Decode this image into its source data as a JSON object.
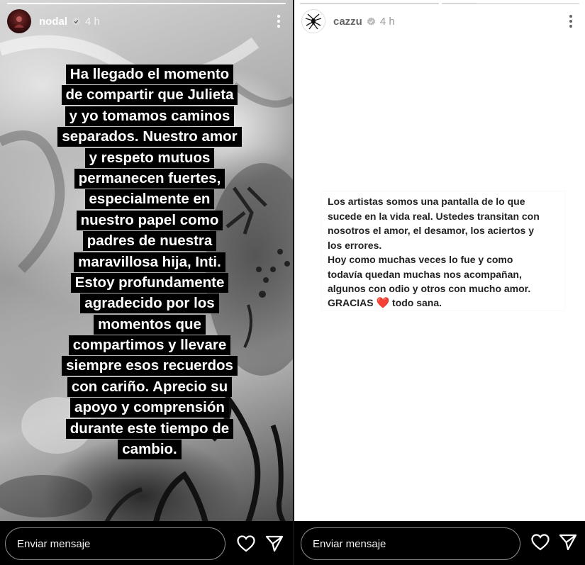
{
  "left_story": {
    "username": "nodal",
    "time": "4 h",
    "progress_fill": 1.0,
    "text_lines": [
      "Ha llegado el momento",
      "de compartir que Julieta",
      "y yo tomamos caminos",
      "separados. Nuestro amor",
      "y respeto mutuos",
      "permanecen fuertes,",
      "especialmente en",
      "nuestro papel como",
      "padres de nuestra",
      "maravillosa hija, Inti.",
      "Estoy profundamente",
      "agradecido por los",
      "momentos que",
      "compartimos y llevare",
      "siempre esos recuerdos",
      "con cariño. Aprecio su",
      "apoyo y comprensión",
      "durante este tiempo de",
      "cambio."
    ],
    "message_placeholder": "Enviar mensaje"
  },
  "right_story": {
    "username": "cazzu",
    "time": "4 h",
    "progress_segments": [
      1.0,
      0.25
    ],
    "paragraph1_lines": [
      "Los artistas somos una pantalla de lo que",
      "sucede en la vida real. Ustedes transitan con",
      "nosotros el amor, el desamor, los aciertos y",
      "los errores."
    ],
    "paragraph2_lines": [
      "Hoy como muchas veces lo fue y como",
      "todavía quedan muchas nos acompañan,",
      "algunos con odio y otros con mucho amor."
    ],
    "gracias_before": "GRACIAS",
    "heart_emoji": "❤️",
    "gracias_after": "todo sana.",
    "message_placeholder": "Enviar mensaje"
  },
  "icons": {
    "verified": "verified-badge-icon",
    "more": "more-options-icon",
    "like": "heart-outline-icon",
    "share": "paper-plane-icon"
  },
  "colors": {
    "verified_blue": "#3897f0",
    "heart_red": "#d10f1f",
    "bar_bg": "#000000"
  }
}
